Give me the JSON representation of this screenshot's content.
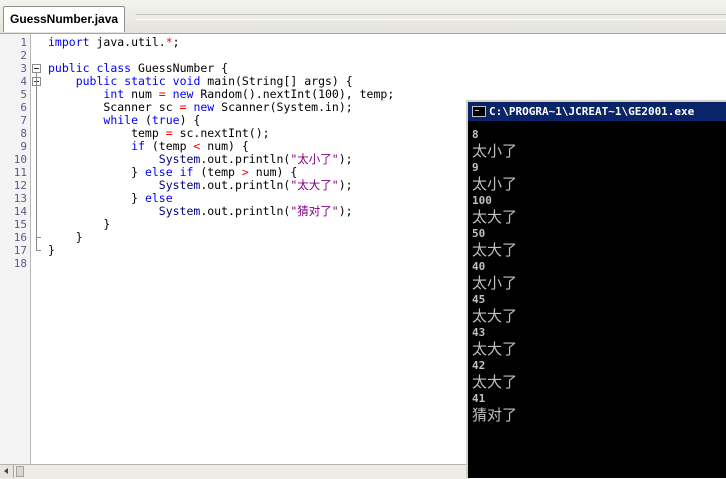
{
  "tab": {
    "label": "GuessNumber.java"
  },
  "colors": {
    "keyword": "#0000ff",
    "operator": "#ff0000",
    "string": "#800080",
    "console_bg": "#000000",
    "console_title_bg": "#0a246a"
  },
  "editor": {
    "line_numbers": [
      "1",
      "2",
      "3",
      "4",
      "5",
      "6",
      "7",
      "8",
      "9",
      "10",
      "11",
      "12",
      "13",
      "14",
      "15",
      "16",
      "17",
      "18"
    ],
    "lines": [
      [
        {
          "t": "import",
          "c": "kw"
        },
        {
          "t": " java.util."
        },
        {
          "t": "*",
          "c": "op"
        },
        {
          "t": ";"
        }
      ],
      [],
      [
        {
          "t": "public",
          "c": "kw"
        },
        {
          "t": " "
        },
        {
          "t": "class",
          "c": "kw"
        },
        {
          "t": " GuessNumber {"
        }
      ],
      [
        {
          "t": "    "
        },
        {
          "t": "public",
          "c": "kw"
        },
        {
          "t": " "
        },
        {
          "t": "static",
          "c": "kw"
        },
        {
          "t": " "
        },
        {
          "t": "void",
          "c": "kw"
        },
        {
          "t": " main(String[] args) {"
        }
      ],
      [
        {
          "t": "        "
        },
        {
          "t": "int",
          "c": "kw"
        },
        {
          "t": " num "
        },
        {
          "t": "=",
          "c": "op"
        },
        {
          "t": " "
        },
        {
          "t": "new",
          "c": "kw"
        },
        {
          "t": " Random().nextInt(100), temp;"
        }
      ],
      [
        {
          "t": "        Scanner sc "
        },
        {
          "t": "=",
          "c": "op"
        },
        {
          "t": " "
        },
        {
          "t": "new",
          "c": "kw"
        },
        {
          "t": " Scanner(System.in);"
        }
      ],
      [
        {
          "t": "        "
        },
        {
          "t": "while",
          "c": "kw"
        },
        {
          "t": " ("
        },
        {
          "t": "true",
          "c": "kw"
        },
        {
          "t": ") {"
        }
      ],
      [
        {
          "t": "            temp "
        },
        {
          "t": "=",
          "c": "op"
        },
        {
          "t": " sc.nextInt();"
        }
      ],
      [
        {
          "t": "            "
        },
        {
          "t": "if",
          "c": "kw"
        },
        {
          "t": " (temp "
        },
        {
          "t": "<",
          "c": "op"
        },
        {
          "t": " num) {"
        }
      ],
      [
        {
          "t": "                "
        },
        {
          "t": "System",
          "c": "cls"
        },
        {
          "t": ".out.println("
        },
        {
          "t": "\"太小了\"",
          "c": "str"
        },
        {
          "t": ");"
        }
      ],
      [
        {
          "t": "            } "
        },
        {
          "t": "else",
          "c": "kw"
        },
        {
          "t": " "
        },
        {
          "t": "if",
          "c": "kw"
        },
        {
          "t": " (temp "
        },
        {
          "t": ">",
          "c": "op"
        },
        {
          "t": " num) {"
        }
      ],
      [
        {
          "t": "                "
        },
        {
          "t": "System",
          "c": "cls"
        },
        {
          "t": ".out.println("
        },
        {
          "t": "\"太大了\"",
          "c": "str"
        },
        {
          "t": ");"
        }
      ],
      [
        {
          "t": "            } "
        },
        {
          "t": "else",
          "c": "kw"
        }
      ],
      [
        {
          "t": "                "
        },
        {
          "t": "System",
          "c": "cls"
        },
        {
          "t": ".out.println("
        },
        {
          "t": "\"猜对了\"",
          "c": "str"
        },
        {
          "t": ");"
        }
      ],
      [
        {
          "t": "        }"
        }
      ],
      [
        {
          "t": "    }"
        }
      ],
      [
        {
          "t": "}"
        }
      ],
      []
    ]
  },
  "console": {
    "title": "C:\\PROGRA~1\\JCREAT~1\\GE2001.exe",
    "lines": [
      {
        "text": "8",
        "kind": "input"
      },
      {
        "text": "太小了",
        "kind": "output"
      },
      {
        "text": "9",
        "kind": "input"
      },
      {
        "text": "太小了",
        "kind": "output"
      },
      {
        "text": "100",
        "kind": "input"
      },
      {
        "text": "太大了",
        "kind": "output"
      },
      {
        "text": "50",
        "kind": "input"
      },
      {
        "text": "太大了",
        "kind": "output"
      },
      {
        "text": "40",
        "kind": "input"
      },
      {
        "text": "太小了",
        "kind": "output"
      },
      {
        "text": "45",
        "kind": "input"
      },
      {
        "text": "太大了",
        "kind": "output"
      },
      {
        "text": "43",
        "kind": "input"
      },
      {
        "text": "太大了",
        "kind": "output"
      },
      {
        "text": "42",
        "kind": "input"
      },
      {
        "text": "太大了",
        "kind": "output"
      },
      {
        "text": "41",
        "kind": "input"
      },
      {
        "text": "猜对了",
        "kind": "output"
      }
    ]
  }
}
